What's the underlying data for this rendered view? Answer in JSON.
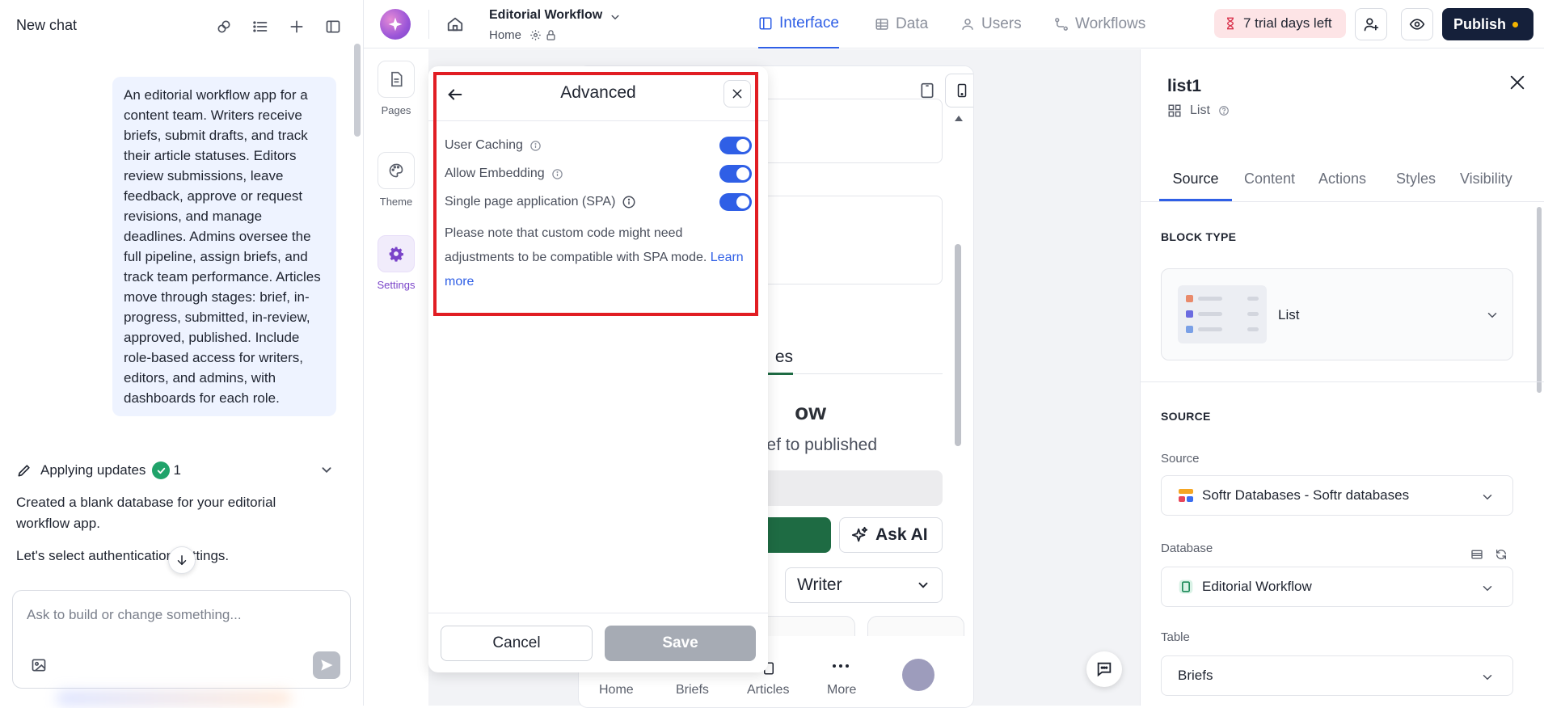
{
  "chat": {
    "title": "New chat",
    "user_message": "An editorial workflow app for a content team. Writers receive briefs, submit drafts, and track their article statuses. Editors review submissions, leave feedback, approve or request revisions, and manage deadlines. Admins oversee the full pipeline, assign briefs, and track team performance. Articles move through stages: brief, in-progress, submitted, in-review, approved, published. Include role-based access for writers, editors, and admins, with dashboards for each role.",
    "applying_label": "Applying updates",
    "applying_count": "1",
    "assistant_line_1": "Created a blank database for your editorial workflow app.",
    "assistant_line_2": "Let's select authentication settings.",
    "composer_placeholder": "Ask to build or change something..."
  },
  "topbar": {
    "app_name": "Editorial Workflow",
    "page_name": "Home",
    "tabs": [
      {
        "label": "Interface",
        "icon": "layout-icon",
        "active": true
      },
      {
        "label": "Data",
        "icon": "table-icon",
        "active": false
      },
      {
        "label": "Users",
        "icon": "user-icon",
        "active": false
      },
      {
        "label": "Workflows",
        "icon": "workflow-icon",
        "active": false
      }
    ],
    "trial_label": "7 trial days left",
    "publish_label": "Publish"
  },
  "rail": {
    "items": [
      {
        "label": "Pages",
        "icon": "page-icon",
        "active": false
      },
      {
        "label": "Theme",
        "icon": "palette-icon",
        "active": false
      },
      {
        "label": "Settings",
        "icon": "gear-icon",
        "active": true
      }
    ]
  },
  "preview": {
    "tab_partial": "es",
    "heading_partial": "ow",
    "subheading_partial": "ef to published",
    "ask_ai_label": "Ask AI",
    "role_select": "Writer",
    "bottom_nav": [
      "Home",
      "Briefs",
      "Articles",
      "More"
    ]
  },
  "advanced": {
    "title": "Advanced",
    "options": [
      {
        "label": "User Caching",
        "enabled": true
      },
      {
        "label": "Allow Embedding",
        "enabled": true
      },
      {
        "label": "Single page application (SPA)",
        "enabled": true
      }
    ],
    "note": "Please note that custom code might need adjustments to be compatible with SPA mode.",
    "learn_more": "Learn more",
    "cancel_label": "Cancel",
    "save_label": "Save"
  },
  "properties": {
    "title": "list1",
    "subtitle": "List",
    "tabs": [
      {
        "label": "Source",
        "active": true
      },
      {
        "label": "Content",
        "active": false
      },
      {
        "label": "Actions",
        "active": false
      },
      {
        "label": "Styles",
        "active": false
      },
      {
        "label": "Visibility",
        "active": false
      }
    ],
    "block_type_heading": "BLOCK TYPE",
    "block_type_value": "List",
    "source_heading": "SOURCE",
    "source_label": "Source",
    "source_value": "Softr Databases - Softr databases",
    "database_label": "Database",
    "database_value": "Editorial Workflow",
    "table_label": "Table",
    "table_value": "Briefs"
  },
  "colors": {
    "accent": "#2f5fe6",
    "publish_bg": "#15203a",
    "trial_bg": "#fde4e6",
    "highlight_border": "#e11d23",
    "preview_green": "#1e6b43",
    "settings_purple": "#7a44c9"
  }
}
